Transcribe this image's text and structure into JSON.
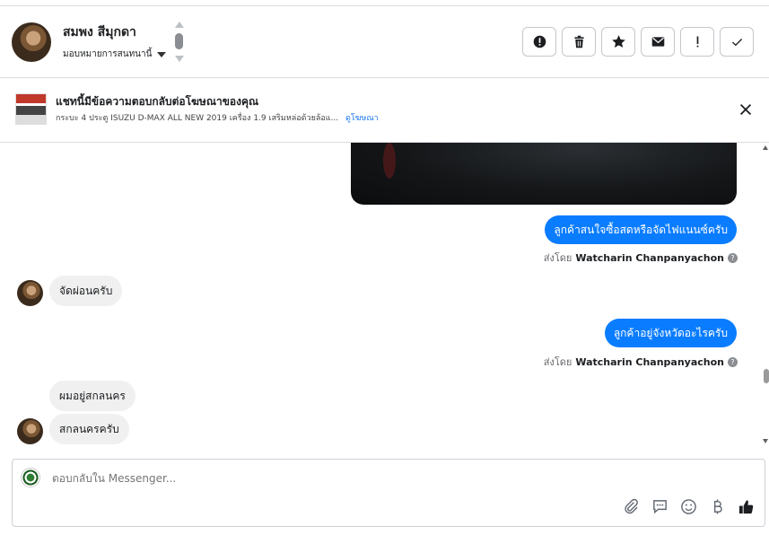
{
  "header": {
    "name": "สมพง สีมุกดา",
    "assign_label": "มอบหมายการสนทนานี้",
    "actions": [
      {
        "name": "report-icon",
        "glyph": "!"
      },
      {
        "name": "trash-icon",
        "glyph": ""
      },
      {
        "name": "star-icon",
        "glyph": "★"
      },
      {
        "name": "mail-icon",
        "glyph": "✉"
      },
      {
        "name": "exclamation-icon",
        "glyph": "!"
      },
      {
        "name": "check-icon",
        "glyph": "✓"
      }
    ]
  },
  "ad": {
    "title": "แชทนี้มีข้อความตอบกลับต่อโฆษณาของคุณ",
    "subtitle": "กระบะ 4 ประตู ISUZU D-MAX ALL NEW 2019 เครื่อง 1.9 เสริมหล่อด้วยล้อแ...",
    "link": "ดูโฆษณา"
  },
  "messages": {
    "m1": "ลูกค้าสนใจซื้อสดหรือจัดไฟแนนซ์ครับ",
    "sent_prefix": "ส่งโดย",
    "sender": "Watcharin Chanpanyachon",
    "m2": "จัดผ่อนครับ",
    "m3": "ลูกค้าอยู่จังหวัดอะไรครับ",
    "m4": "ผมอยู่สกลนคร",
    "m5": "สกลนครครับ"
  },
  "composer": {
    "placeholder": "ตอบกลับใน Messenger..."
  },
  "colors": {
    "accent": "#0a7cff",
    "incoming_bubble": "#f0f0f0",
    "border": "#dadde1"
  }
}
